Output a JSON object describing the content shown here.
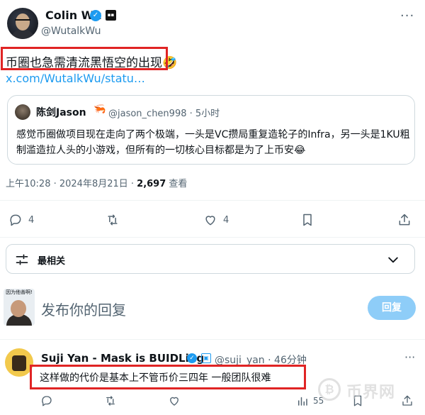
{
  "tweet": {
    "author_name": "Colin Wu",
    "author_handle": "@WutalkWu",
    "text": "币圈也急需清流黑悟空的出现🤣",
    "link": "x.com/WutalkWu/statu…",
    "timestamp": "上午10:28 · 2024年8月21日 · ",
    "views_count": "2,697",
    "views_label": " 查看"
  },
  "quoted": {
    "author_name": "陈剑Jason",
    "author_handle": "@jason_chen998 · 5小时",
    "text": "感觉币圈做项目现在走向了两个极端，一头是VC攒局重复造轮子的Infra，另一头是1KU粗制滥造拉人头的小游戏，但所有的一切核心目标都是为了上币安😂"
  },
  "actions": {
    "replies": "4",
    "likes": "4"
  },
  "sort": {
    "label": "最相关"
  },
  "compose": {
    "avatar_caption": "因为他善啊!",
    "placeholder": "发布你的回复",
    "button": "回复"
  },
  "reply": {
    "author_name": "Suji Yan - Mask is BUIDLing",
    "author_handle": "@suji_yan · 46分钟",
    "text": "这样做的代价是基本上不管币价三四年 一般团队很难",
    "views": "55"
  },
  "watermark": {
    "text": "币界网"
  },
  "colors": {
    "accent": "#1d9bf0",
    "highlight": "#e02424",
    "muted": "#536471"
  }
}
